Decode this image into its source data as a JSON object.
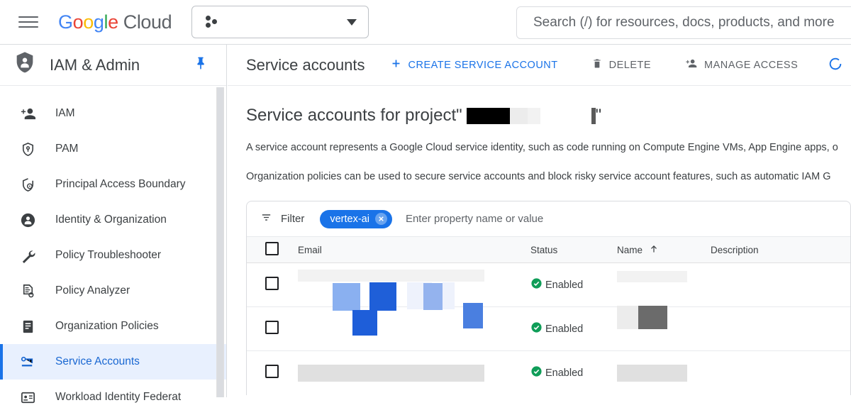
{
  "topbar": {
    "menu_icon": "hamburger-menu-icon",
    "logo_google": "Google",
    "logo_cloud": "Cloud",
    "project_picker_icon": "project-dots-icon",
    "project_picker_caret": "chevron-down-icon",
    "search_placeholder": "Search (/) for resources, docs, products, and more"
  },
  "panel": {
    "icon": "shield-person-icon",
    "title": "IAM & Admin",
    "pin_icon": "pin-icon",
    "items": [
      {
        "label": "IAM",
        "icon": "person-add-icon",
        "selected": false
      },
      {
        "label": "PAM",
        "icon": "shield-pin-icon",
        "selected": false
      },
      {
        "label": "Principal Access Boundary",
        "icon": "shield-user-icon",
        "selected": false
      },
      {
        "label": "Identity & Organization",
        "icon": "account-circle-icon",
        "selected": false
      },
      {
        "label": "Policy Troubleshooter",
        "icon": "wrench-icon",
        "selected": false
      },
      {
        "label": "Policy Analyzer",
        "icon": "document-search-icon",
        "selected": false
      },
      {
        "label": "Organization Policies",
        "icon": "list-document-icon",
        "selected": false
      },
      {
        "label": "Service Accounts",
        "icon": "key-card-icon",
        "selected": true
      },
      {
        "label": "Workload Identity Federat",
        "icon": "badge-icon",
        "selected": false
      }
    ]
  },
  "main": {
    "title": "Service accounts",
    "toolbar": [
      {
        "label": "CREATE SERVICE ACCOUNT",
        "icon": "plus-icon",
        "style": "primary"
      },
      {
        "label": "DELETE",
        "icon": "trash-icon",
        "style": "muted"
      },
      {
        "label": "MANAGE ACCESS",
        "icon": "person-add-icon",
        "style": "muted"
      },
      {
        "label": "",
        "icon": "refresh-icon",
        "style": "primary-icon-only"
      }
    ],
    "project_heading_prefix": "Service accounts for project ",
    "project_heading_quote_open": "\"",
    "project_heading_quote_close": "\"",
    "description_line_1": "A service account represents a Google Cloud service identity, such as code running on Compute Engine VMs, App Engine apps, o",
    "description_line_2": "Organization policies can be used to secure service accounts and block risky service account features, such as automatic IAM G"
  },
  "filter": {
    "icon": "filter-icon",
    "label": "Filter",
    "chip_label": "vertex-ai",
    "chip_remove_icon": "close-circle-icon",
    "input_placeholder": "Enter property name or value"
  },
  "table": {
    "select_all_checkbox": "checkbox-unchecked",
    "columns": [
      {
        "key": "email",
        "label": "Email"
      },
      {
        "key": "status",
        "label": "Status"
      },
      {
        "key": "name",
        "label": "Name",
        "sort_icon": "arrow-up-icon",
        "sorted": "asc"
      },
      {
        "key": "description",
        "label": "Description"
      }
    ],
    "rows": [
      {
        "checkbox": "checkbox-unchecked",
        "email": "",
        "email_redacted": true,
        "status": "Enabled",
        "status_icon": "check-circle-icon",
        "name": "",
        "name_redacted": true,
        "description": ""
      },
      {
        "checkbox": "checkbox-unchecked",
        "email": "",
        "email_redacted": true,
        "status": "Enabled",
        "status_icon": "check-circle-icon",
        "name": "",
        "name_redacted": true,
        "description": ""
      },
      {
        "checkbox": "checkbox-unchecked",
        "email": "",
        "email_redacted": true,
        "status": "Enabled",
        "status_icon": "check-circle-icon",
        "name": "",
        "name_redacted": true,
        "description": ""
      }
    ]
  },
  "colors": {
    "google_blue": "#4285F4",
    "google_red": "#EA4335",
    "google_yellow": "#FBBC05",
    "google_green": "#34A853",
    "accent_blue": "#1a73e8",
    "chip_blue": "#1a73e8",
    "selected_bg": "#e8f0fe",
    "status_green": "#0f9d58",
    "text_primary": "#3c4043",
    "text_muted": "#5f6368",
    "border": "#dadce0"
  }
}
